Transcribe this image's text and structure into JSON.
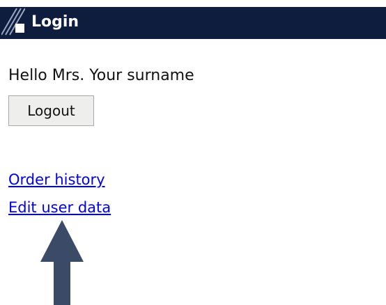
{
  "header": {
    "title": "Login",
    "bar_color": "#0e1d3e",
    "icon": "stripes-square-icon"
  },
  "greeting": {
    "text": "Hello Mrs. Your surname"
  },
  "logout_button": {
    "label": "Logout"
  },
  "links": {
    "order_history": "Order history",
    "edit_user_data": "Edit user data",
    "color": "#0000ee"
  },
  "annotation": {
    "icon": "up-arrow-icon",
    "color": "#3b4a66"
  }
}
